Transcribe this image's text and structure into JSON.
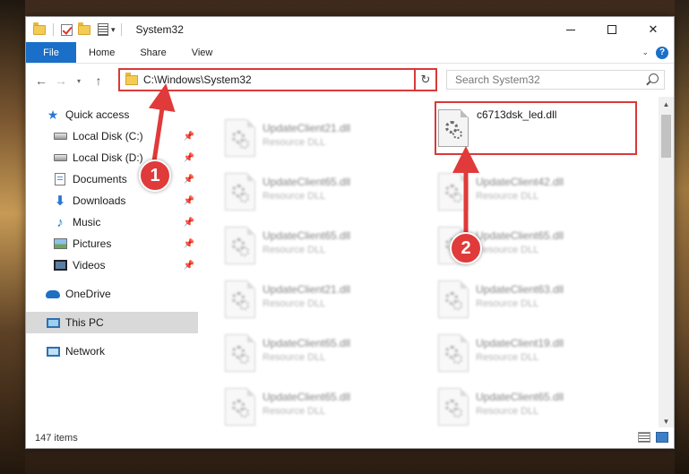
{
  "window": {
    "title": "System32"
  },
  "ribbon": {
    "file": "File",
    "home": "Home",
    "share": "Share",
    "view": "View"
  },
  "address": {
    "path": "C:\\Windows\\System32"
  },
  "search": {
    "placeholder": "Search System32"
  },
  "sidebar": {
    "items": [
      {
        "label": "Quick access",
        "icon": "star-icon",
        "pinned": false
      },
      {
        "label": "Local Disk (C:)",
        "icon": "disk-icon",
        "pinned": true
      },
      {
        "label": "Local Disk (D:)",
        "icon": "disk-icon",
        "pinned": true
      },
      {
        "label": "Documents",
        "icon": "document-icon",
        "pinned": true
      },
      {
        "label": "Downloads",
        "icon": "download-icon",
        "pinned": true
      },
      {
        "label": "Music",
        "icon": "music-icon",
        "pinned": true
      },
      {
        "label": "Pictures",
        "icon": "pictures-icon",
        "pinned": true
      },
      {
        "label": "Videos",
        "icon": "video-icon",
        "pinned": true
      },
      {
        "label": "OneDrive",
        "icon": "onedrive-icon",
        "pinned": false
      },
      {
        "label": "This PC",
        "icon": "this-pc-icon",
        "pinned": false,
        "selected": true
      },
      {
        "label": "Network",
        "icon": "network-icon",
        "pinned": false
      }
    ]
  },
  "files": {
    "left": [
      {
        "name": "UpdateClient21.dll",
        "type": "Resource DLL"
      },
      {
        "name": "UpdateClient65.dll",
        "type": "Resource DLL"
      },
      {
        "name": "UpdateClient65.dll",
        "type": "Resource DLL"
      },
      {
        "name": "UpdateClient21.dll",
        "type": "Resource DLL"
      },
      {
        "name": "UpdateClient65.dll",
        "type": "Resource DLL"
      },
      {
        "name": "UpdateClient65.dll",
        "type": "Resource DLL"
      }
    ],
    "highlighted": {
      "name": "c6713dsk_led.dll"
    },
    "right": [
      {
        "name": "UpdateClient42.dll",
        "type": "Resource DLL"
      },
      {
        "name": "UpdateClient65.dll",
        "type": "Resource DLL"
      },
      {
        "name": "UpdateClient63.dll",
        "type": "Resource DLL"
      },
      {
        "name": "UpdateClient19.dll",
        "type": "Resource DLL"
      },
      {
        "name": "UpdateClient65.dll",
        "type": "Resource DLL"
      }
    ]
  },
  "status": {
    "count": "147 items"
  },
  "annotations": {
    "badge1": "1",
    "badge2": "2",
    "color": "#e03a3a"
  }
}
